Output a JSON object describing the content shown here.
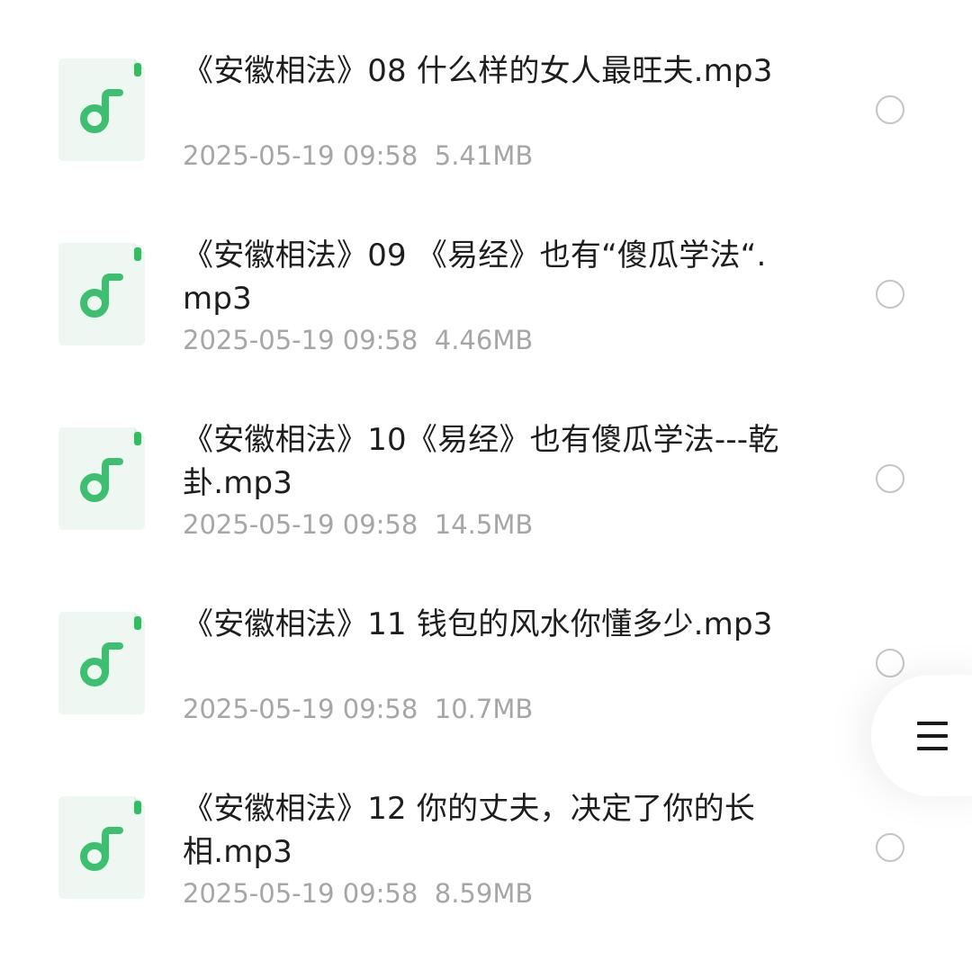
{
  "colors": {
    "accent_green": "#3cc06f",
    "icon_tab_green": "#2fbf5f",
    "name_text": "#1e1e1e",
    "meta_text": "#a6a6a6"
  },
  "files": [
    {
      "name": "《安徽相法》08 什么样的女人最旺夫.mp3",
      "date": "2025-05-19 09:58",
      "size": "5.41MB",
      "icon": "music-file-icon"
    },
    {
      "name": "《安徽相法》09 《易经》也有“傻瓜学法“.mp3",
      "date": "2025-05-19 09:58",
      "size": "4.46MB",
      "icon": "music-file-icon"
    },
    {
      "name": "《安徽相法》10《易经》也有傻瓜学法---乾卦.mp3",
      "date": "2025-05-19 09:58",
      "size": "14.5MB",
      "icon": "music-file-icon"
    },
    {
      "name": "《安徽相法》11 钱包的风水你懂多少.mp3",
      "date": "2025-05-19 09:58",
      "size": "10.7MB",
      "icon": "music-file-icon"
    },
    {
      "name": "《安徽相法》12 你的丈夫，决定了你的长相.mp3",
      "date": "2025-05-19 09:58",
      "size": "8.59MB",
      "icon": "music-file-icon"
    }
  ],
  "menu_button": {
    "icon": "menu-icon"
  }
}
